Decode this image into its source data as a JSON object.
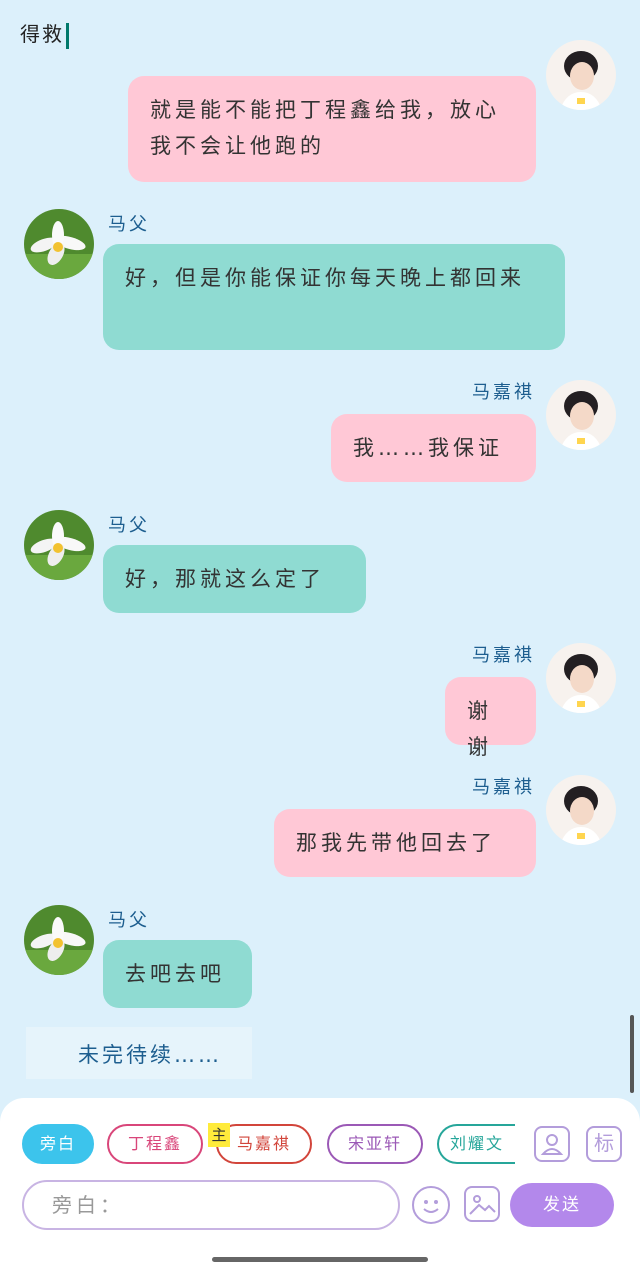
{
  "title": "得救",
  "messages": [
    {
      "side": "right",
      "name": "",
      "text": "就是能不能把丁程鑫给我，放心我不会让他跑的",
      "color": "pink"
    },
    {
      "side": "left",
      "name": "马父",
      "text": "好，但是你能保证你每天晚上都回来",
      "color": "teal"
    },
    {
      "side": "right",
      "name": "马嘉祺",
      "text": "我……我保证",
      "color": "pink"
    },
    {
      "side": "left",
      "name": "马父",
      "text": "好，那就这么定了",
      "color": "teal"
    },
    {
      "side": "right",
      "name": "马嘉祺",
      "text": "谢谢",
      "color": "pink"
    },
    {
      "side": "right",
      "name": "马嘉祺",
      "text": "那我先带他回去了",
      "color": "pink"
    },
    {
      "side": "left",
      "name": "马父",
      "text": "去吧去吧",
      "color": "teal"
    }
  ],
  "narration": "未完待续……",
  "characters": [
    {
      "label": "旁白",
      "active": true,
      "color": "#3cc4ec"
    },
    {
      "label": "丁程鑫",
      "active": false,
      "color": "#d9467a"
    },
    {
      "label": "马嘉祺",
      "active": false,
      "color": "#d2453b"
    },
    {
      "label": "宋亚轩",
      "active": false,
      "color": "#9b59b6"
    },
    {
      "label": "刘耀文",
      "active": false,
      "color": "#26a69a"
    }
  ],
  "main_tag": "主",
  "tag_button_label": "标",
  "input": {
    "placeholder": "旁白："
  },
  "send_label": "发送",
  "colors": {
    "background": "#dcf0fb",
    "pink": "#ffc8d6",
    "teal": "#8fdbd2",
    "name": "#1d5e8f",
    "send": "#b388eb"
  }
}
